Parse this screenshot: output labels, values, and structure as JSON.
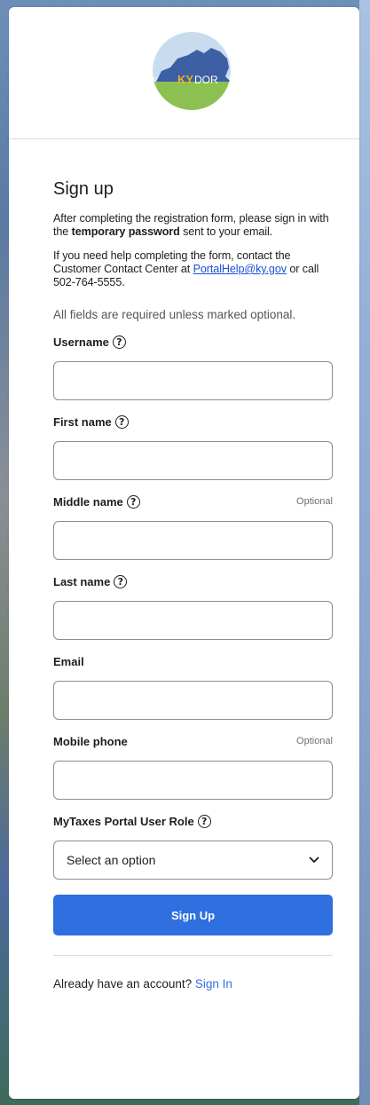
{
  "header": {
    "logo_text_ky": "KY",
    "logo_text_dor": "DOR"
  },
  "form": {
    "title": "Sign up",
    "intro_part1": "After completing the registration form, please sign in with the ",
    "intro_bold": "temporary password",
    "intro_part2": " sent to your email.",
    "help_part1": "If you need help completing the form, contact the Customer Contact Center at ",
    "help_email": "PortalHelp@ky.gov",
    "help_part2": " or call 502-764-5555.",
    "required_note": "All fields are required unless marked optional.",
    "optional_label": "Optional",
    "fields": [
      {
        "label": "Username",
        "help": "?",
        "optional": false,
        "value": ""
      },
      {
        "label": "First name",
        "help": "?",
        "optional": false,
        "value": ""
      },
      {
        "label": "Middle name",
        "help": "?",
        "optional": true,
        "value": ""
      },
      {
        "label": "Last name",
        "help": "?",
        "optional": false,
        "value": ""
      },
      {
        "label": "Email",
        "optional": false,
        "value": ""
      },
      {
        "label": "Mobile phone",
        "optional": true,
        "value": ""
      }
    ],
    "role": {
      "label": "MyTaxes Portal User Role",
      "help": "?",
      "selected": "Select an option"
    },
    "submit_label": "Sign Up",
    "footer_prompt": "Already have an account? ",
    "footer_link": "Sign In"
  },
  "colors": {
    "accent": "#2f6fe0",
    "link": "#1a4fd6",
    "logo_sky": "#3f5fa6",
    "logo_land": "#3d5fa3",
    "logo_grass": "#8cc152"
  }
}
